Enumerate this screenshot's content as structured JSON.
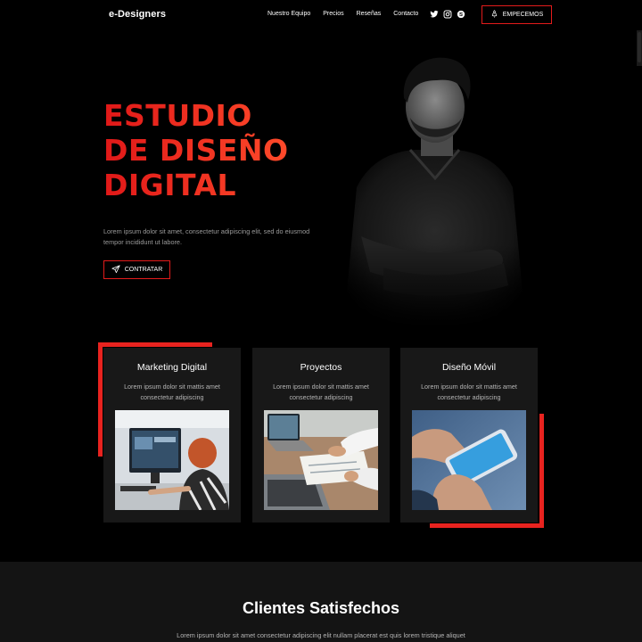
{
  "nav": {
    "logo": "e-Designers",
    "links": [
      "Nuestro Equipo",
      "Precios",
      "Reseñas",
      "Contacto"
    ],
    "social_icons": [
      "twitter-icon",
      "instagram-icon",
      "skype-icon"
    ],
    "cta_label": "EMPECEMOS",
    "cta_icon": "rocket-icon"
  },
  "hero": {
    "title_lines": [
      "ESTUDIO",
      "DE DISEÑO",
      "DIGITAL"
    ],
    "text": "Lorem ipsum dolor sit amet, consectetur adipiscing elit, sed do eiusmod tempor incididunt ut labore.",
    "button_label": "CONTRATAR",
    "button_icon": "paper-plane-icon"
  },
  "cards": [
    {
      "title": "Marketing Digital",
      "text": "Lorem ipsum dolor sit mattis amet consectetur adipiscing"
    },
    {
      "title": "Proyectos",
      "text": "Lorem ipsum dolor sit mattis amet consectetur adipiscing"
    },
    {
      "title": "Diseño Móvil",
      "text": "Lorem ipsum dolor sit mattis amet consectetur adipiscing"
    }
  ],
  "clients": {
    "title": "Clientes Satisfechos",
    "text": "Lorem ipsum dolor sit amet consectetur adipiscing elit nullam placerat est quis lorem tristique aliquet"
  },
  "colors": {
    "accent": "#e8231f",
    "background": "#000000",
    "card": "#181818",
    "section": "#141414"
  }
}
